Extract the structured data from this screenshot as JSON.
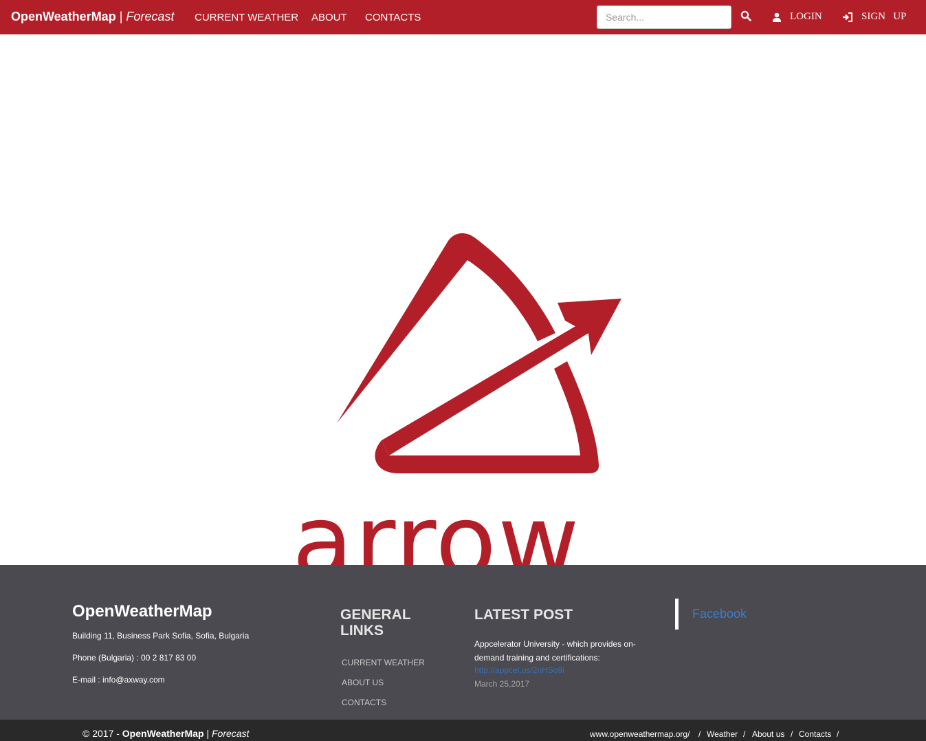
{
  "navbar": {
    "brand_bold": "OpenWeatherMap",
    "brand_sep": "|",
    "brand_italic": "Forecast",
    "links": [
      "CURRENT WEATHER",
      "ABOUT",
      "CONTACTS"
    ],
    "search_placeholder": "Search...",
    "login_label": "LOGIN",
    "signup_label": "SIGN   UP",
    "accent_color": "#b31f28"
  },
  "hero": {
    "logo_text": "arrow",
    "logo_color": "#b31f28"
  },
  "footer": {
    "title": "OpenWeatherMap",
    "address": "Building 11, Business Park Sofia, Sofia, Bulgaria",
    "phone": "Phone (Bulgaria) : 00 2 817 83 00",
    "email": "E-mail : info@axway.com",
    "general_links_heading_1": "GENERAL",
    "general_links_heading_2": "LINKS",
    "general_links": [
      "CURRENT WEATHER",
      "ABOUT US",
      "CONTACTS"
    ],
    "latest_post_heading": "LATEST POST",
    "latest_post_text": "Appcelerator University - which provides on-demand training and certifications:",
    "latest_post_url": "http://appcel.us/2nHSo9i",
    "latest_post_date": "March 25,2017",
    "facebook_label": "Facebook",
    "background_color": "#4a4a50"
  },
  "bottombar": {
    "copyright_prefix": "© 2017 -",
    "copyright_bold": "OpenWeatherMap",
    "copyright_sep": "|",
    "copyright_italic": "Forecast",
    "links": [
      "www.openweathermap.org/",
      "Weather",
      "About us",
      "Contacts"
    ],
    "separator": "/"
  }
}
